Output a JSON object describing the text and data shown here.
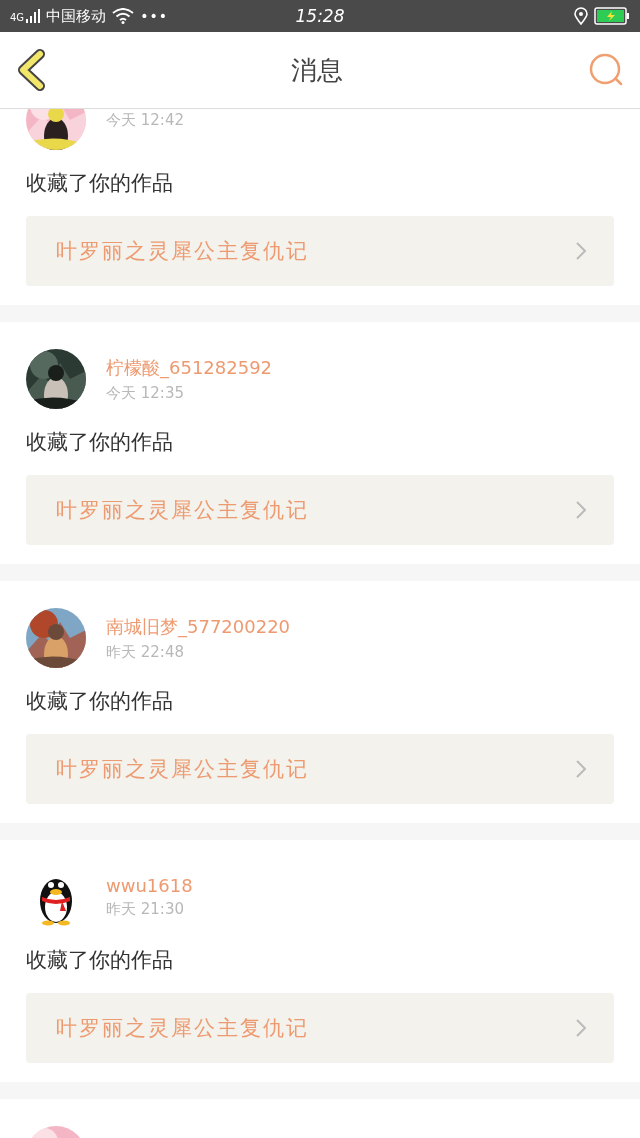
{
  "status_bar": {
    "network": "4G",
    "carrier": "中国移动",
    "more": "•••",
    "time": "15:28"
  },
  "header": {
    "title": "消息"
  },
  "messages": [
    {
      "avatar": {
        "kind": "picture"
      },
      "time": "今天 12:42",
      "action": "收藏了你的作品",
      "work": "叶罗丽之灵犀公主复仇记"
    },
    {
      "avatar": {
        "kind": "picture"
      },
      "username": "柠檬酸_651282592",
      "time": "今天 12:35",
      "action": "收藏了你的作品",
      "work": "叶罗丽之灵犀公主复仇记"
    },
    {
      "avatar": {
        "kind": "picture"
      },
      "username": "南城旧梦_577200220",
      "time": "昨天 22:48",
      "action": "收藏了你的作品",
      "work": "叶罗丽之灵犀公主复仇记"
    },
    {
      "avatar": {
        "kind": "penguin"
      },
      "username": "wwu1618",
      "time": "昨天 21:30",
      "action": "收藏了你的作品",
      "work": "叶罗丽之灵犀公主复仇记"
    },
    {
      "avatar": {
        "kind": "picture"
      }
    }
  ]
}
